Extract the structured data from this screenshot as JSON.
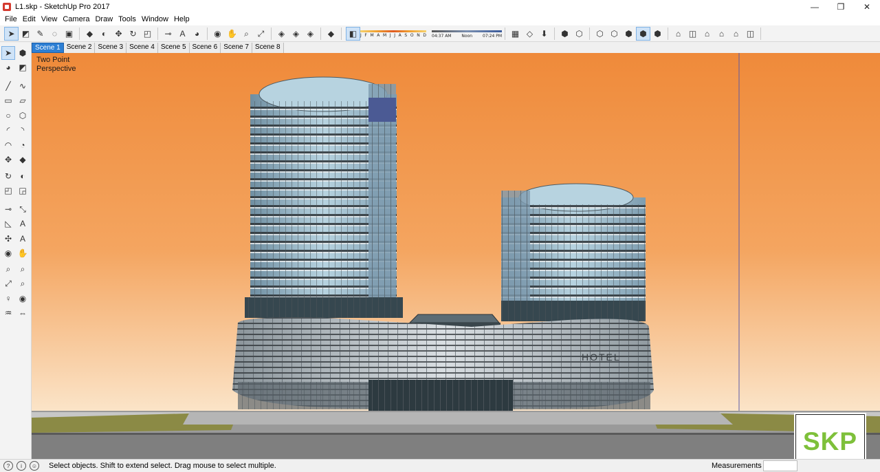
{
  "window": {
    "title": "L1.skp - SketchUp Pro 2017",
    "minimize_glyph": "—",
    "restore_glyph": "❐",
    "close_glyph": "✕"
  },
  "menu": [
    "File",
    "Edit",
    "View",
    "Camera",
    "Draw",
    "Tools",
    "Window",
    "Help"
  ],
  "toolbar": {
    "groups": [
      [
        {
          "name": "select-tool-icon",
          "glyph": "➤",
          "active": true
        },
        {
          "name": "eraser-tool-icon",
          "glyph": "◩"
        },
        {
          "name": "pencil-line-tool-icon",
          "glyph": "✎"
        },
        {
          "name": "lasso-tool-icon",
          "glyph": "◌"
        },
        {
          "name": "paint-bucket-tool-icon",
          "glyph": "▣"
        }
      ],
      [
        {
          "name": "push-pull-tool-icon",
          "glyph": "◆"
        },
        {
          "name": "follow-me-tool-icon",
          "glyph": "◐"
        },
        {
          "name": "move-tool-icon",
          "glyph": "✥"
        },
        {
          "name": "rotate-tool-icon",
          "glyph": "↻"
        },
        {
          "name": "scale-tool-icon",
          "glyph": "◰"
        }
      ],
      [
        {
          "name": "tape-measure-tool-icon",
          "glyph": "⊸"
        },
        {
          "name": "text-tool-icon",
          "glyph": "A"
        },
        {
          "name": "paint-tool-icon",
          "glyph": "◕"
        }
      ],
      [
        {
          "name": "orbit-tool-icon",
          "glyph": "◉"
        },
        {
          "name": "pan-tool-icon",
          "glyph": "✋"
        },
        {
          "name": "zoom-tool-icon",
          "glyph": "⌕"
        },
        {
          "name": "zoom-extents-tool-icon",
          "glyph": "⤢"
        }
      ],
      [
        {
          "name": "3d-warehouse-icon",
          "glyph": "◈"
        },
        {
          "name": "share-model-icon",
          "glyph": "◈"
        },
        {
          "name": "extension-warehouse-icon",
          "glyph": "◈"
        }
      ],
      [
        {
          "name": "ruby-console-icon",
          "glyph": "◆"
        }
      ]
    ],
    "shadow_toggle": {
      "name": "shadow-toggle-icon",
      "glyph": "◧",
      "active": true
    },
    "months": [
      "J",
      "F",
      "M",
      "A",
      "M",
      "J",
      "J",
      "A",
      "S",
      "O",
      "N",
      "D"
    ],
    "time_start": "04:37 AM",
    "time_noon": "Noon",
    "time_end": "07:24 PM",
    "groups_after": [
      [
        {
          "name": "section-plane-icon",
          "glyph": "▦"
        },
        {
          "name": "section-display-icon",
          "glyph": "◇"
        },
        {
          "name": "section-cut-icon",
          "glyph": "⬇"
        }
      ],
      [
        {
          "name": "xray-style-icon",
          "glyph": "⬢"
        },
        {
          "name": "back-edges-style-icon",
          "glyph": "⬡"
        }
      ],
      [
        {
          "name": "wireframe-style-icon",
          "glyph": "⬡"
        },
        {
          "name": "hidden-line-style-icon",
          "glyph": "⬡"
        },
        {
          "name": "shaded-style-icon",
          "glyph": "⬢"
        },
        {
          "name": "shaded-textures-style-icon",
          "glyph": "⬢",
          "active": true
        },
        {
          "name": "monochrome-style-icon",
          "glyph": "⬢"
        }
      ],
      [
        {
          "name": "iso-view-icon",
          "glyph": "⌂"
        },
        {
          "name": "top-view-icon",
          "glyph": "◫"
        },
        {
          "name": "front-view-icon",
          "glyph": "⌂"
        },
        {
          "name": "right-view-icon",
          "glyph": "⌂"
        },
        {
          "name": "back-view-icon",
          "glyph": "⌂"
        },
        {
          "name": "left-view-icon",
          "glyph": "◫"
        }
      ]
    ]
  },
  "palette": [
    {
      "name": "select-tool-icon",
      "glyph": "➤",
      "active": true
    },
    {
      "name": "make-component-icon",
      "glyph": "⬢"
    },
    {
      "name": "paint-bucket-icon",
      "glyph": "◕"
    },
    {
      "name": "eraser-icon",
      "glyph": "◩"
    },
    {
      "name": "line-tool-icon",
      "glyph": "╱"
    },
    {
      "name": "freehand-tool-icon",
      "glyph": "∿"
    },
    {
      "name": "rectangle-tool-icon",
      "glyph": "▭"
    },
    {
      "name": "rotated-rectangle-icon",
      "glyph": "▱"
    },
    {
      "name": "circle-tool-icon",
      "glyph": "○"
    },
    {
      "name": "polygon-tool-icon",
      "glyph": "⬡"
    },
    {
      "name": "arc-tool-icon",
      "glyph": "◜"
    },
    {
      "name": "two-point-arc-icon",
      "glyph": "◝"
    },
    {
      "name": "three-point-arc-icon",
      "glyph": "◠"
    },
    {
      "name": "pie-tool-icon",
      "glyph": "◔"
    },
    {
      "name": "move-tool-icon",
      "glyph": "✥"
    },
    {
      "name": "push-pull-icon",
      "glyph": "◆"
    },
    {
      "name": "rotate-tool-icon",
      "glyph": "↻"
    },
    {
      "name": "follow-me-icon",
      "glyph": "◐"
    },
    {
      "name": "scale-tool-icon",
      "glyph": "◰"
    },
    {
      "name": "offset-tool-icon",
      "glyph": "◲"
    },
    {
      "name": "tape-measure-icon",
      "glyph": "⊸"
    },
    {
      "name": "dimension-tool-icon",
      "glyph": "⤡"
    },
    {
      "name": "protractor-icon",
      "glyph": "◺"
    },
    {
      "name": "text-tool-icon",
      "glyph": "A"
    },
    {
      "name": "axes-tool-icon",
      "glyph": "✣"
    },
    {
      "name": "3d-text-icon",
      "glyph": "A"
    },
    {
      "name": "orbit-icon",
      "glyph": "◉"
    },
    {
      "name": "pan-icon",
      "glyph": "✋"
    },
    {
      "name": "zoom-icon",
      "glyph": "⌕"
    },
    {
      "name": "zoom-window-icon",
      "glyph": "⌕"
    },
    {
      "name": "zoom-extents-icon",
      "glyph": "⤢"
    },
    {
      "name": "previous-view-icon",
      "glyph": "⌕"
    },
    {
      "name": "position-camera-icon",
      "glyph": "♀"
    },
    {
      "name": "look-around-icon",
      "glyph": "◉"
    },
    {
      "name": "walk-icon",
      "glyph": "♒"
    },
    {
      "name": "section-plane-icon",
      "glyph": "⇔"
    }
  ],
  "scenes": [
    "Scene 1",
    "Scene 2",
    "Scene 3",
    "Scene 4",
    "Scene 5",
    "Scene 6",
    "Scene 7",
    "Scene 8"
  ],
  "active_scene": 0,
  "viewport": {
    "label_line1": "Two Point",
    "label_line2": "Perspective",
    "sky_top": "#ef8a3a",
    "sky_bottom": "#fbe4c8",
    "hotel_sign": "HOTEL"
  },
  "badge": {
    "text": "SKP"
  },
  "status": {
    "message": "Select objects. Shift to extend select. Drag mouse to select multiple.",
    "measurements_label": "Measurements",
    "measurements_value": ""
  },
  "colors": {
    "accent": "#2d7fd4",
    "glass": "#a9c8d6",
    "skp_green": "#7ec03a"
  }
}
